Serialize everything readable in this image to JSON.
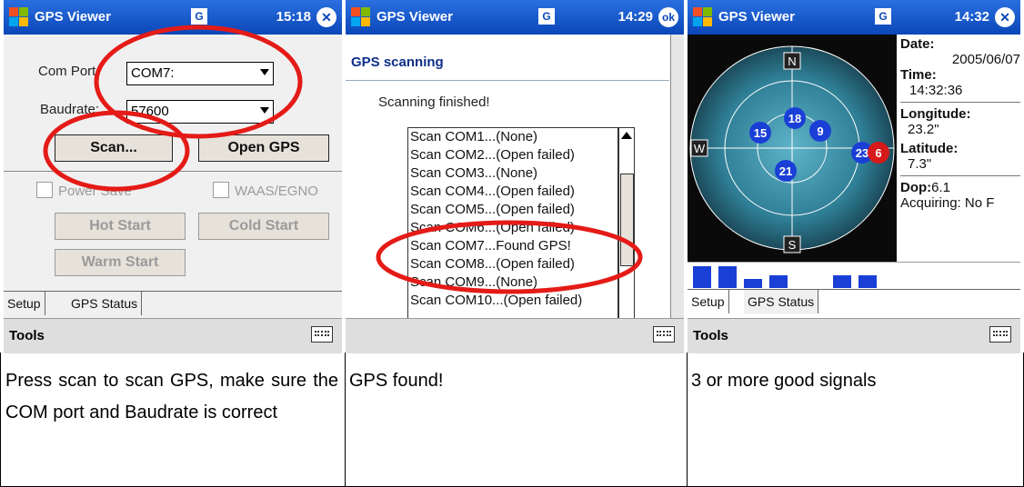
{
  "panels": {
    "p1": {
      "title": "GPS Viewer",
      "status": "15:18",
      "close": "✕",
      "com_port_label": "Com Port:",
      "com_port_value": "COM7:",
      "baudrate_label": "Baudrate:",
      "baudrate_value": "57600",
      "scan_button": "Scan...",
      "open_gps_button": "Open GPS",
      "power_save": "Power Save",
      "waas": "WAAS/EGNO",
      "hot_start": "Hot Start",
      "cold_start": "Cold Start",
      "warm_start": "Warm Start",
      "tab_setup": "Setup",
      "tab_gps_status": "GPS Status",
      "tools": "Tools"
    },
    "p2": {
      "title": "GPS Viewer",
      "status": "14:29",
      "ok": "ok",
      "header": "GPS scanning",
      "finished": "Scanning finished!",
      "rows": [
        "Scan COM1...(None)",
        "Scan COM2...(Open failed)",
        "Scan COM3...(None)",
        "Scan COM4...(Open failed)",
        "Scan COM5...(Open failed)",
        "Scan COM6...(Open failed)",
        "Scan COM7...Found GPS!",
        "Scan COM8...(Open failed)",
        "Scan COM9...(None)",
        "Scan COM10...(Open failed)"
      ]
    },
    "p3": {
      "title": "GPS Viewer",
      "status": "14:32",
      "close": "✕",
      "compass_n": "N",
      "compass_w": "W",
      "compass_s": "S",
      "satellites": [
        "18",
        "15",
        "9",
        "21",
        "23",
        "6"
      ],
      "date_label": "Date:",
      "date_value": "2005/06/07",
      "time_label": "Time:",
      "time_value": "14:32:36",
      "longitude_label": "Longitude:",
      "longitude_value": "23.2\"",
      "latitude_label": "Latitude:",
      "latitude_value": "7.3\"",
      "dop_label": "Dop:",
      "dop_value": "6.1",
      "acquiring": "Acquiring: No F",
      "tab_setup": "Setup",
      "tab_gps_status": "GPS Status",
      "tools": "Tools"
    }
  },
  "captions": {
    "c1": "Press scan to scan GPS, make sure the COM port and Baudrate is correct",
    "c2": "GPS found!",
    "c3": "3 or more good signals"
  },
  "colors": {
    "titlebar": "#1a5bd6",
    "highlight_ring": "#e41b17",
    "sat_blue": "#1a3fd6",
    "sat_red": "#d61a1a"
  }
}
